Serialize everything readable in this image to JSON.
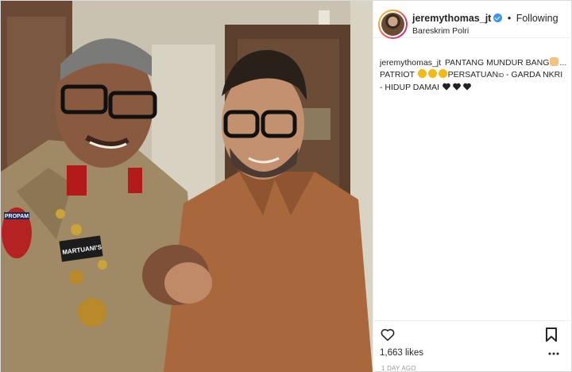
{
  "post": {
    "username": "jeremythomas_jt",
    "separator": "•",
    "following_label": "Following",
    "location": "Bareskrim Polri",
    "caption": {
      "username": "jeremythomas_jt",
      "part1": "PANTANG MUNDUR BANG",
      "part2": "... PATRIOT ",
      "part3": "PERSATUAN",
      "flag_text": "ID",
      "part4": " - GARDA NKRI - HIDUP DAMAI "
    },
    "likes": "1,663 likes",
    "timestamp": "1 DAY AGO"
  },
  "photo": {
    "uniform_tag": "PROPAM",
    "name_tag": "MARTUANI'S"
  },
  "colors": {
    "accent": "#3897f0",
    "border": "#efefef",
    "text": "#262626",
    "muted": "#999999"
  },
  "icons": {
    "verified": "verified-badge-icon",
    "like": "heart-outline-icon",
    "save": "bookmark-icon",
    "more": "more-dots-icon"
  }
}
